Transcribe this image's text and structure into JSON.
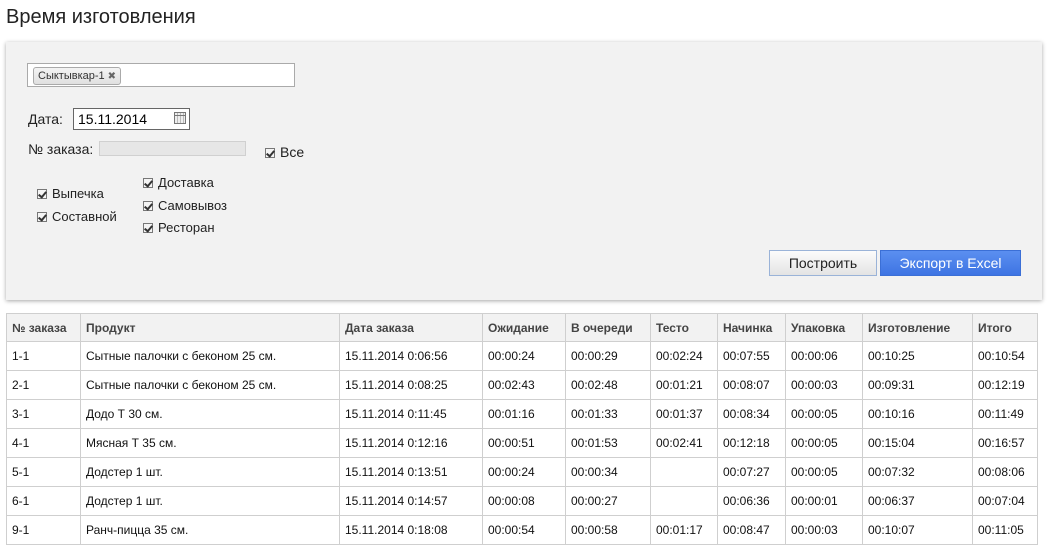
{
  "page": {
    "title": "Время изготовления"
  },
  "filters": {
    "store_tag": "Сыктывкар-1",
    "store_tag_remove": "✖",
    "date_label": "Дата:",
    "date_value": "15.11.2014",
    "order_label": "№ заказа:",
    "order_value": "",
    "all_label": "Все",
    "checkboxes_left": [
      "Выпечка",
      "Составной"
    ],
    "checkboxes_right": [
      "Доставка",
      "Самовывоз",
      "Ресторан"
    ]
  },
  "buttons": {
    "build": "Построить",
    "export": "Экспорт в Excel"
  },
  "table": {
    "columns": [
      "№ заказа",
      "Продукт",
      "Дата заказа",
      "Ожидание",
      "В очереди",
      "Тесто",
      "Начинка",
      "Упаковка",
      "Изготовление",
      "Итого"
    ],
    "rows": [
      [
        "1-1",
        "Сытные палочки с беконом 25 см.",
        "15.11.2014 0:06:56",
        "00:00:24",
        "00:00:29",
        "00:02:24",
        "00:07:55",
        "00:00:06",
        "00:10:25",
        "00:10:54"
      ],
      [
        "2-1",
        "Сытные палочки с беконом 25 см.",
        "15.11.2014 0:08:25",
        "00:02:43",
        "00:02:48",
        "00:01:21",
        "00:08:07",
        "00:00:03",
        "00:09:31",
        "00:12:19"
      ],
      [
        "3-1",
        "Додо Т 30 см.",
        "15.11.2014 0:11:45",
        "00:01:16",
        "00:01:33",
        "00:01:37",
        "00:08:34",
        "00:00:05",
        "00:10:16",
        "00:11:49"
      ],
      [
        "4-1",
        "Мясная Т 35 см.",
        "15.11.2014 0:12:16",
        "00:00:51",
        "00:01:53",
        "00:02:41",
        "00:12:18",
        "00:00:05",
        "00:15:04",
        "00:16:57"
      ],
      [
        "5-1",
        "Додстер 1 шт.",
        "15.11.2014 0:13:51",
        "00:00:24",
        "00:00:34",
        "",
        "00:07:27",
        "00:00:05",
        "00:07:32",
        "00:08:06"
      ],
      [
        "6-1",
        "Додстер 1 шт.",
        "15.11.2014 0:14:57",
        "00:00:08",
        "00:00:27",
        "",
        "00:06:36",
        "00:00:01",
        "00:06:37",
        "00:07:04"
      ],
      [
        "9-1",
        "Ранч-пицца 35 см.",
        "15.11.2014 0:18:08",
        "00:00:54",
        "00:00:58",
        "00:01:17",
        "00:08:47",
        "00:00:03",
        "00:10:07",
        "00:11:05"
      ]
    ]
  }
}
